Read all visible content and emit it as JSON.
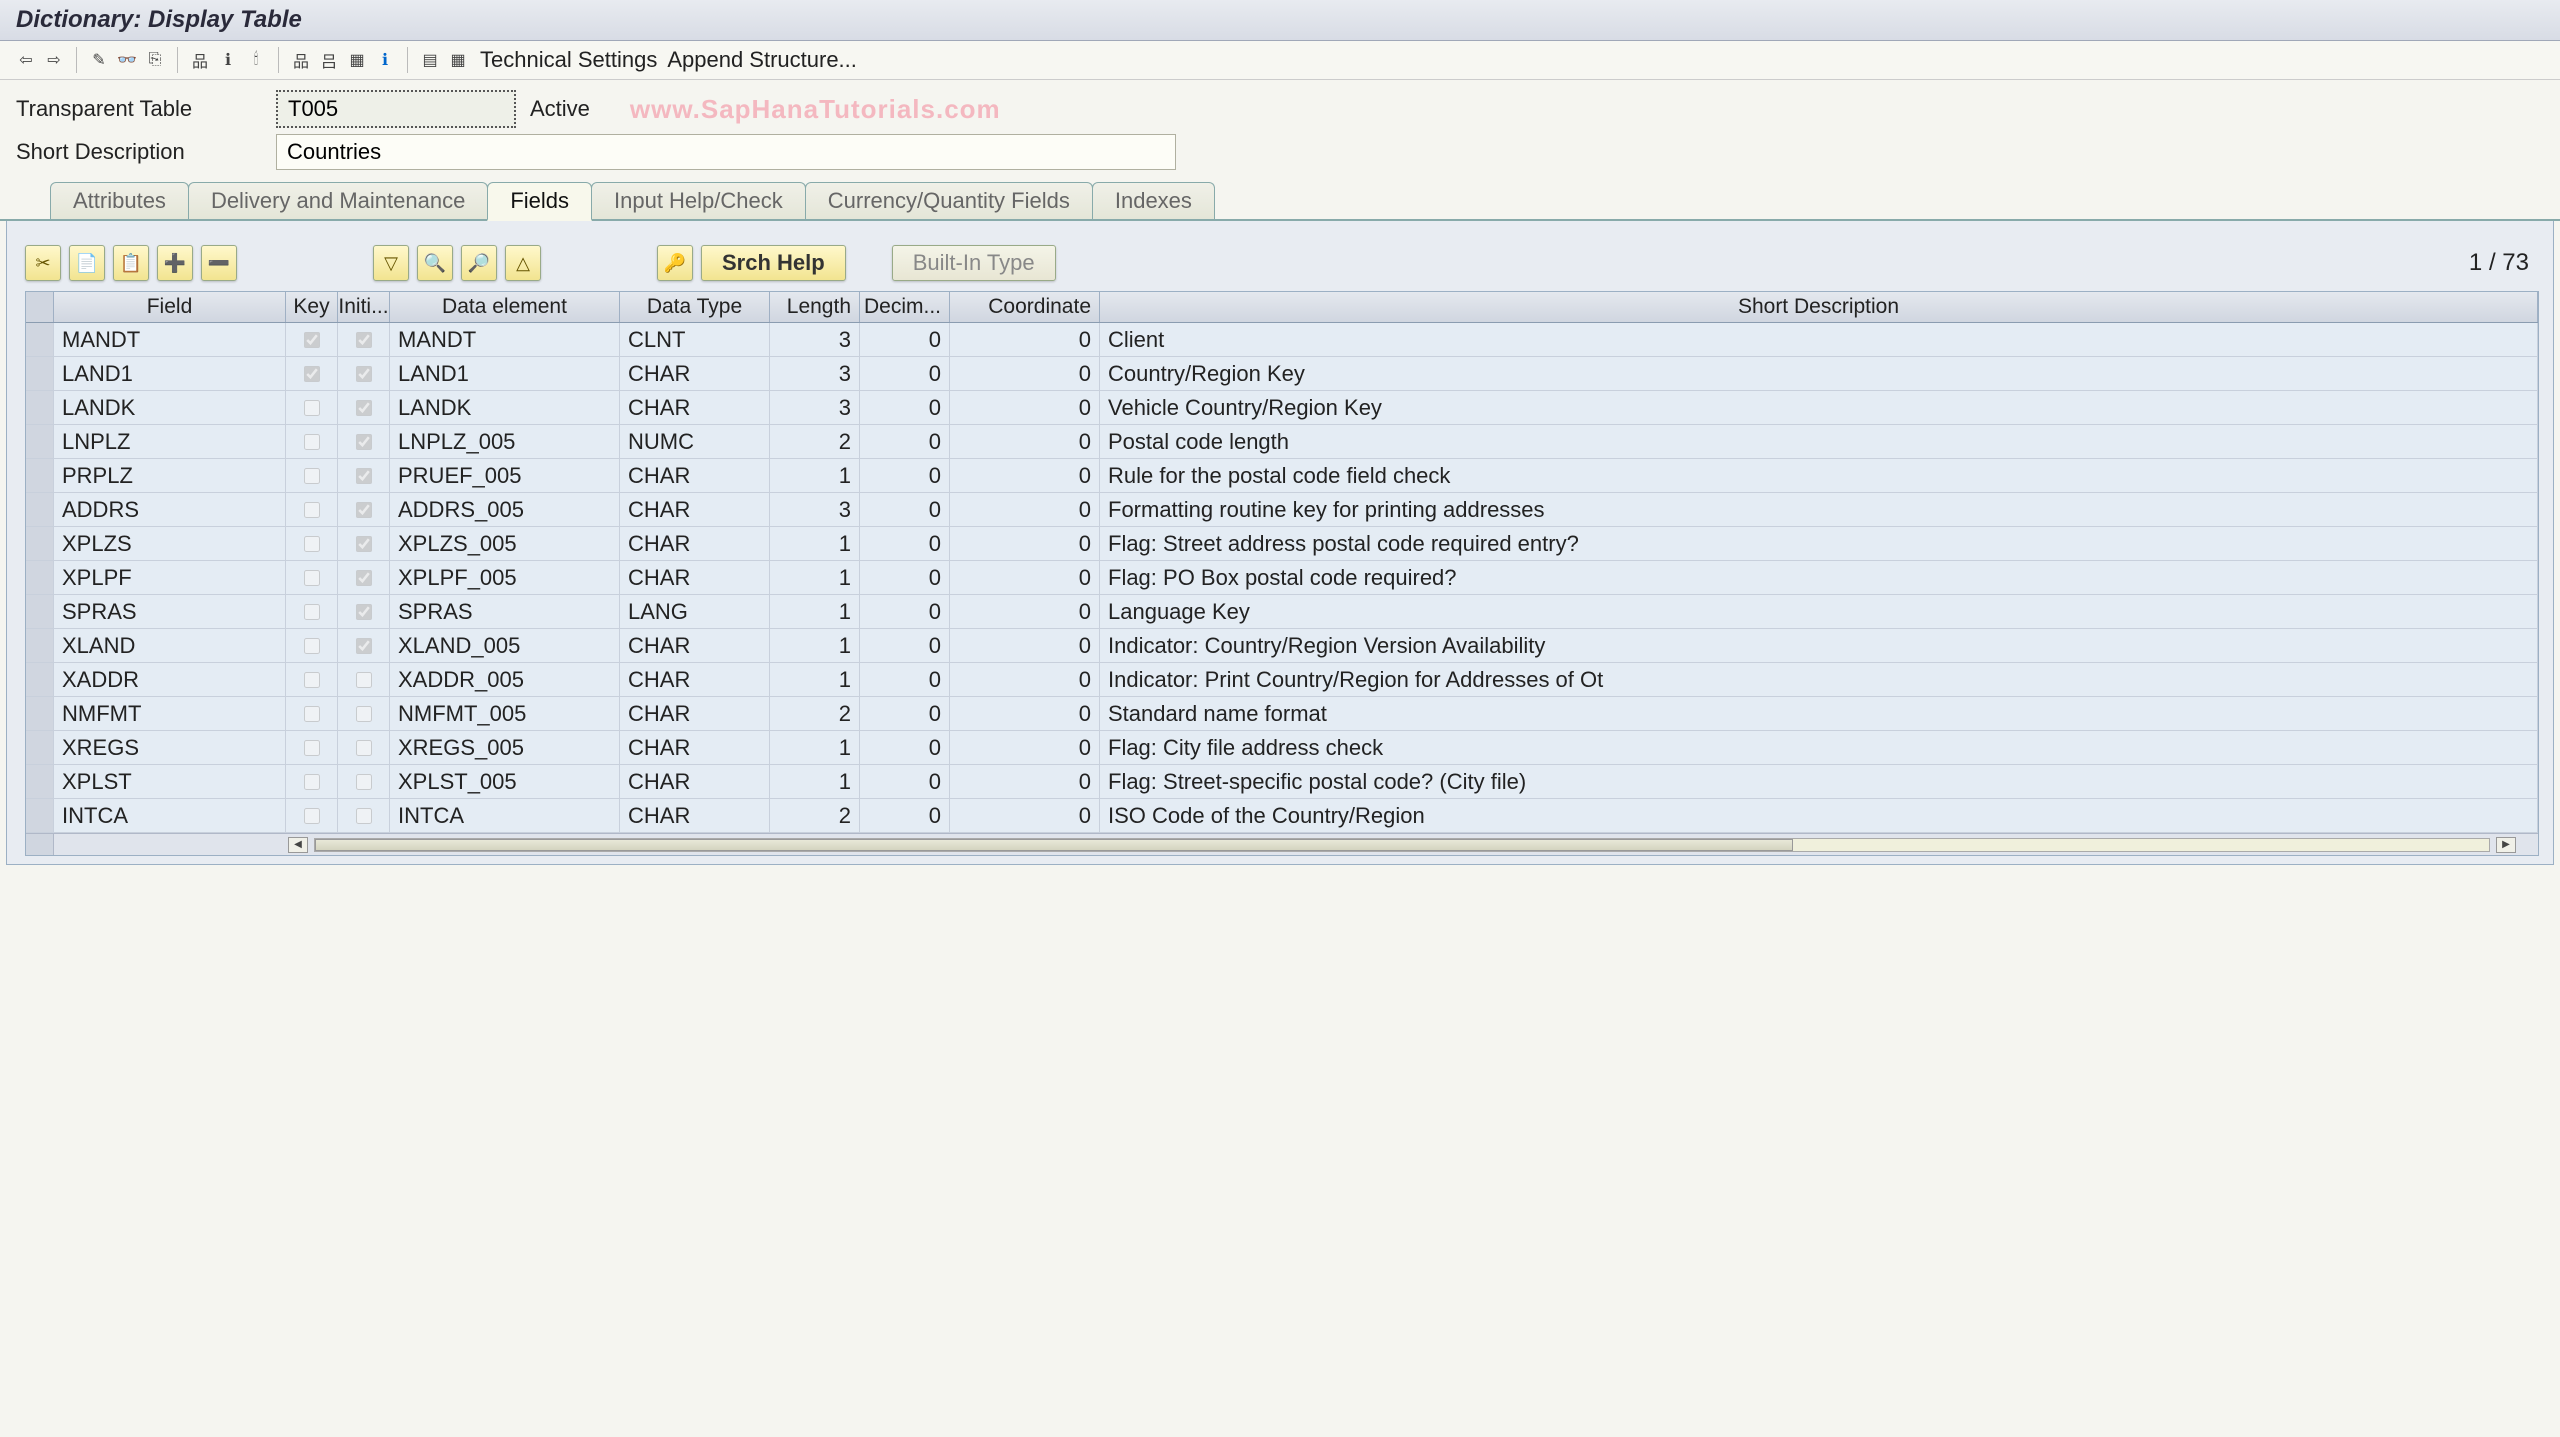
{
  "window_title": "Dictionary: Display Table",
  "toolbar_labels": {
    "tech_settings": "Technical Settings",
    "append_struct": "Append Structure..."
  },
  "header": {
    "table_label": "Transparent Table",
    "table_name": "T005",
    "status": "Active",
    "watermark": "www.SapHanaTutorials.com",
    "desc_label": "Short Description",
    "desc_value": "Countries"
  },
  "tabs": [
    "Attributes",
    "Delivery and Maintenance",
    "Fields",
    "Input Help/Check",
    "Currency/Quantity Fields",
    "Indexes"
  ],
  "active_tab_index": 2,
  "buttons": {
    "srch_help": "Srch Help",
    "builtin": "Built-In Type"
  },
  "counter": {
    "current": "1",
    "total": "73"
  },
  "grid_headers": {
    "field": "Field",
    "key": "Key",
    "init": "Initi...",
    "elem": "Data element",
    "type": "Data Type",
    "len": "Length",
    "dec": "Decim...",
    "coord": "Coordinate",
    "desc": "Short Description"
  },
  "rows": [
    {
      "field": "MANDT",
      "key": true,
      "init": true,
      "elem": "MANDT",
      "type": "CLNT",
      "len": "3",
      "dec": "0",
      "coord": "0",
      "desc": "Client"
    },
    {
      "field": "LAND1",
      "key": true,
      "init": true,
      "elem": "LAND1",
      "type": "CHAR",
      "len": "3",
      "dec": "0",
      "coord": "0",
      "desc": "Country/Region Key"
    },
    {
      "field": "LANDK",
      "key": false,
      "init": true,
      "elem": "LANDK",
      "type": "CHAR",
      "len": "3",
      "dec": "0",
      "coord": "0",
      "desc": "Vehicle Country/Region Key"
    },
    {
      "field": "LNPLZ",
      "key": false,
      "init": true,
      "elem": "LNPLZ_005",
      "type": "NUMC",
      "len": "2",
      "dec": "0",
      "coord": "0",
      "desc": "Postal code length"
    },
    {
      "field": "PRPLZ",
      "key": false,
      "init": true,
      "elem": "PRUEF_005",
      "type": "CHAR",
      "len": "1",
      "dec": "0",
      "coord": "0",
      "desc": "Rule for the postal code field check"
    },
    {
      "field": "ADDRS",
      "key": false,
      "init": true,
      "elem": "ADDRS_005",
      "type": "CHAR",
      "len": "3",
      "dec": "0",
      "coord": "0",
      "desc": "Formatting routine key for printing addresses"
    },
    {
      "field": "XPLZS",
      "key": false,
      "init": true,
      "elem": "XPLZS_005",
      "type": "CHAR",
      "len": "1",
      "dec": "0",
      "coord": "0",
      "desc": "Flag: Street address postal code required entry?"
    },
    {
      "field": "XPLPF",
      "key": false,
      "init": true,
      "elem": "XPLPF_005",
      "type": "CHAR",
      "len": "1",
      "dec": "0",
      "coord": "0",
      "desc": "Flag: PO Box postal code required?"
    },
    {
      "field": "SPRAS",
      "key": false,
      "init": true,
      "elem": "SPRAS",
      "type": "LANG",
      "len": "1",
      "dec": "0",
      "coord": "0",
      "desc": "Language Key"
    },
    {
      "field": "XLAND",
      "key": false,
      "init": true,
      "elem": "XLAND_005",
      "type": "CHAR",
      "len": "1",
      "dec": "0",
      "coord": "0",
      "desc": "Indicator: Country/Region Version Availability"
    },
    {
      "field": "XADDR",
      "key": false,
      "init": false,
      "elem": "XADDR_005",
      "type": "CHAR",
      "len": "1",
      "dec": "0",
      "coord": "0",
      "desc": "Indicator: Print Country/Region for Addresses of Ot"
    },
    {
      "field": "NMFMT",
      "key": false,
      "init": false,
      "elem": "NMFMT_005",
      "type": "CHAR",
      "len": "2",
      "dec": "0",
      "coord": "0",
      "desc": "Standard name format"
    },
    {
      "field": "XREGS",
      "key": false,
      "init": false,
      "elem": "XREGS_005",
      "type": "CHAR",
      "len": "1",
      "dec": "0",
      "coord": "0",
      "desc": "Flag: City file address check"
    },
    {
      "field": "XPLST",
      "key": false,
      "init": false,
      "elem": "XPLST_005",
      "type": "CHAR",
      "len": "1",
      "dec": "0",
      "coord": "0",
      "desc": "Flag: Street-specific postal code? (City file)"
    },
    {
      "field": "INTCA",
      "key": false,
      "init": false,
      "elem": "INTCA",
      "type": "CHAR",
      "len": "2",
      "dec": "0",
      "coord": "0",
      "desc": "ISO Code of the Country/Region"
    }
  ]
}
